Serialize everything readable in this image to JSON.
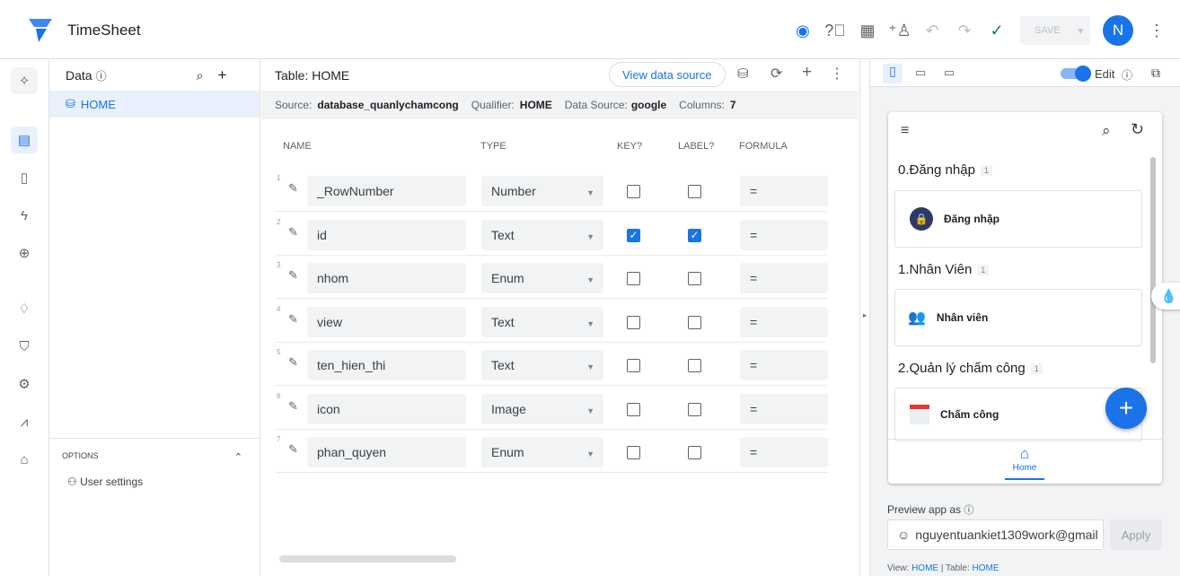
{
  "app": {
    "title": "TimeSheet",
    "brand_color": "#1a73e8"
  },
  "topbar": {
    "save_label": "SAVE",
    "avatar_letter": "N"
  },
  "data_panel": {
    "title": "Data",
    "items": [
      {
        "label": "HOME"
      }
    ],
    "options_label": "OPTIONS",
    "user_settings": "User settings"
  },
  "table": {
    "title": "Table: HOME",
    "view_source": "View data source",
    "source_label": "Source:",
    "source": "database_quanlychamcong",
    "qualifier_label": "Qualifier:",
    "qualifier": "HOME",
    "ds_label": "Data Source:",
    "ds": "google",
    "columns_label": "Columns:",
    "columns": "7",
    "headers": [
      "NAME",
      "TYPE",
      "KEY?",
      "LABEL?",
      "FORMULA"
    ],
    "rows": [
      {
        "n": "1",
        "name": "_RowNumber",
        "type": "Number",
        "key": false,
        "label": false,
        "formula": "="
      },
      {
        "n": "2",
        "name": "id",
        "type": "Text",
        "key": true,
        "label": true,
        "formula": "="
      },
      {
        "n": "3",
        "name": "nhom",
        "type": "Enum",
        "key": false,
        "label": false,
        "formula": "="
      },
      {
        "n": "4",
        "name": "view",
        "type": "Text",
        "key": false,
        "label": false,
        "formula": "="
      },
      {
        "n": "5",
        "name": "ten_hien_thi",
        "type": "Text",
        "key": false,
        "label": false,
        "formula": "="
      },
      {
        "n": "6",
        "name": "icon",
        "type": "Image",
        "key": false,
        "label": false,
        "formula": "="
      },
      {
        "n": "7",
        "name": "phan_quyen",
        "type": "Enum",
        "key": false,
        "label": false,
        "formula": "="
      }
    ]
  },
  "preview": {
    "edit_label": "Edit",
    "sections": [
      {
        "title": "0.Đăng nhập",
        "count": "1",
        "card": "Đăng nhập"
      },
      {
        "title": "1.Nhân Viên",
        "count": "1",
        "card": "Nhân viên"
      },
      {
        "title": "2.Quản lý chấm công",
        "count": "1",
        "card": "Chấm công"
      }
    ],
    "nav_home": "Home",
    "preview_as_label": "Preview app as",
    "preview_email": "nguyentuankiet1309work@gmail",
    "apply_label": "Apply",
    "footer_view_label": "View:",
    "footer_view": "HOME",
    "footer_table_label": "Table:",
    "footer_table": "HOME"
  }
}
